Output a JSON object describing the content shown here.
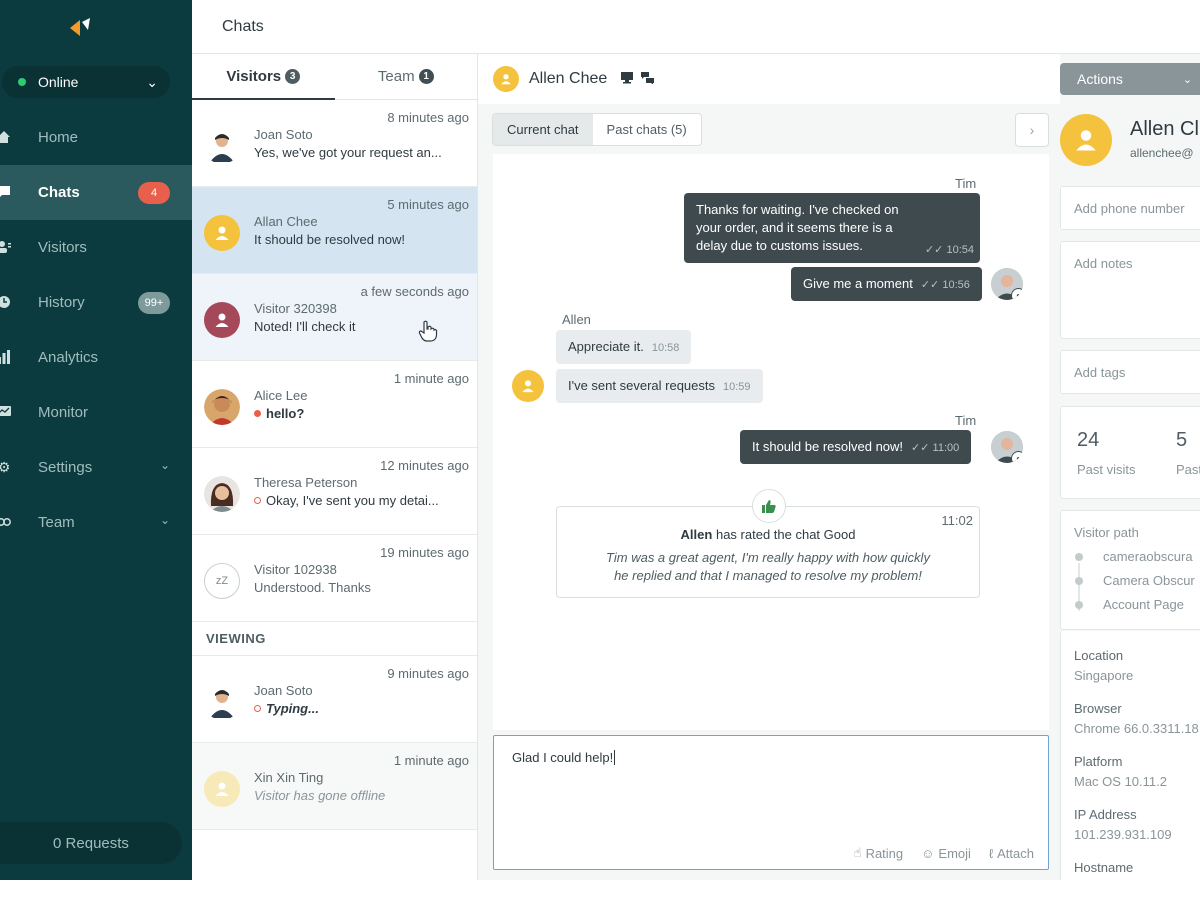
{
  "header": {
    "title": "Chats"
  },
  "sidebar": {
    "status": "Online",
    "items": [
      {
        "label": "Home",
        "icon": "home-icon"
      },
      {
        "label": "Chats",
        "icon": "chat-bubble-icon",
        "badge": "4"
      },
      {
        "label": "Visitors",
        "icon": "visitors-icon"
      },
      {
        "label": "History",
        "icon": "history-clock-icon",
        "badge": "99+"
      },
      {
        "label": "Analytics",
        "icon": "analytics-bars-icon"
      },
      {
        "label": "Monitor",
        "icon": "monitor-icon"
      },
      {
        "label": "Settings",
        "icon": "settings-gear-icon"
      },
      {
        "label": "Team",
        "icon": "team-icon"
      }
    ],
    "requests": "0 Requests"
  },
  "chat_list": {
    "tabs": [
      {
        "label": "Visitors",
        "count": "3"
      },
      {
        "label": "Team",
        "count": "1"
      }
    ],
    "rows": [
      {
        "time": "8 minutes ago",
        "name": "Joan Soto",
        "message": "Yes, we've got your request an..."
      },
      {
        "time": "5 minutes ago",
        "name": "Allan Chee",
        "message": "It should be resolved now!"
      },
      {
        "time": "a few seconds ago",
        "name": "Visitor 320398",
        "message": "Noted! I'll check it"
      },
      {
        "time": "1 minute ago",
        "name": "Alice Lee",
        "message": "hello?"
      },
      {
        "time": "12 minutes ago",
        "name": "Theresa Peterson",
        "message": "Okay, I've sent you my detai..."
      },
      {
        "time": "19 minutes ago",
        "name": "Visitor 102938",
        "message": "Understood. Thanks",
        "avatar_text": "zZ"
      }
    ],
    "viewing_label": "VIEWING",
    "viewing_rows": [
      {
        "time": "9 minutes ago",
        "name": "Joan Soto",
        "message": "Typing..."
      },
      {
        "time": "1 minute ago",
        "name": "Xin Xin Ting",
        "message": "Visitor has gone offline"
      }
    ]
  },
  "conversation": {
    "name": "Allen Chee",
    "tabs": [
      "Current chat",
      "Past chats (5)"
    ],
    "messages": [
      {
        "sender": "Tim",
        "text_lines": [
          "Thanks for waiting. I've checked on",
          "your order, and it seems there is a",
          "delay due to customs issues."
        ],
        "time": "10:54"
      },
      {
        "text": "Give me a moment",
        "time": "10:56"
      },
      {
        "sender": "Allen",
        "text": "Appreciate it.",
        "time": "10:58"
      },
      {
        "text": "I've sent several requests",
        "time": "10:59"
      },
      {
        "sender": "Tim",
        "text": "It should be resolved now!",
        "time": "11:00"
      }
    ],
    "rating": {
      "time": "11:02",
      "name": "Allen",
      "action": "has rated the chat Good",
      "comment_lines": [
        "Tim was a great agent, I'm really happy with how quickly",
        "he replied and that I managed to resolve my problem!"
      ]
    },
    "composer": {
      "text": "Glad I could help!",
      "tools": [
        "Rating",
        "Emoji",
        "Attach"
      ]
    }
  },
  "details": {
    "actions_label": "Actions",
    "name": "Allen Cl",
    "email": "allenchee@",
    "phone_placeholder": "Add phone number",
    "notes_placeholder": "Add notes",
    "tags_placeholder": "Add tags",
    "stats": [
      {
        "value": "24",
        "label": "Past visits"
      },
      {
        "value": "5",
        "label": "Past"
      }
    ],
    "visitor_path_title": "Visitor path",
    "visitor_path": [
      "cameraobscura",
      "Camera Obscur",
      "Account Page"
    ],
    "info": [
      {
        "label": "Location",
        "value": "Singapore"
      },
      {
        "label": "Browser",
        "value": "Chrome 66.0.3311.18"
      },
      {
        "label": "Platform",
        "value": "Mac OS 10.11.2"
      },
      {
        "label": "IP Address",
        "value": "101.239.931.109"
      },
      {
        "label": "Hostname",
        "value": ""
      }
    ]
  },
  "colors": {
    "sidebar_bg": "#0c3b3f",
    "sidebar_active": "#2a5a5d",
    "badge_red": "#e8604c",
    "agent_bubble": "#3f4a4e",
    "visitor_bubble": "#e8ecee",
    "selected_row": "#d4e4f0",
    "avatar_yellow": "#f4c23d"
  }
}
